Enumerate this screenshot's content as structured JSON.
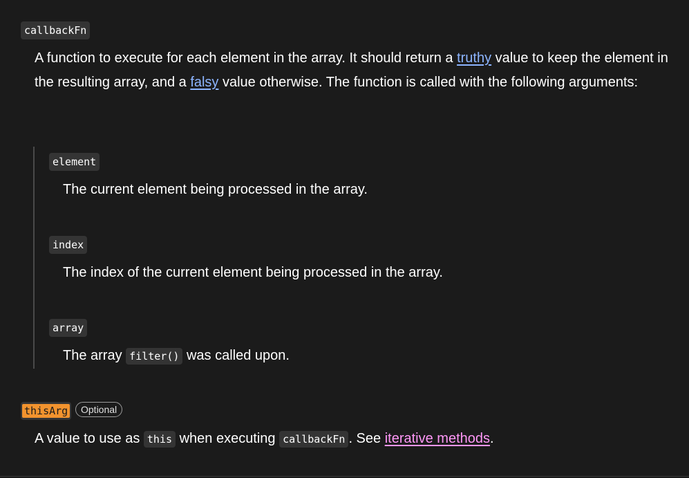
{
  "params": {
    "callback": {
      "name": "callbackFn",
      "desc_pre": "A function to execute for each element in the array. It should return a ",
      "truthy_link": "truthy",
      "desc_mid": " value to keep the element in the resulting array, and a ",
      "falsy_link": "falsy",
      "desc_post": " value otherwise. The function is called with the following arguments:"
    },
    "element": {
      "name": "element",
      "desc": "The current element being processed in the array."
    },
    "index": {
      "name": "index",
      "desc": "The index of the current element being processed in the array."
    },
    "array": {
      "name": "array",
      "desc_pre": "The array ",
      "code": "filter()",
      "desc_post": " was called upon."
    },
    "this_arg": {
      "name": "thisArg",
      "badge": "Optional",
      "desc_pre": "A value to use as ",
      "code_this": "this",
      "desc_mid": " when executing ",
      "code_callback": "callbackFn",
      "desc_mid2": ". See ",
      "link": "iterative methods",
      "desc_post": "."
    }
  },
  "colors": {
    "background": "#1b1b1b",
    "link": "#8cb4ff",
    "visited_link": "#ff97f7",
    "highlight": "#f2932e"
  }
}
